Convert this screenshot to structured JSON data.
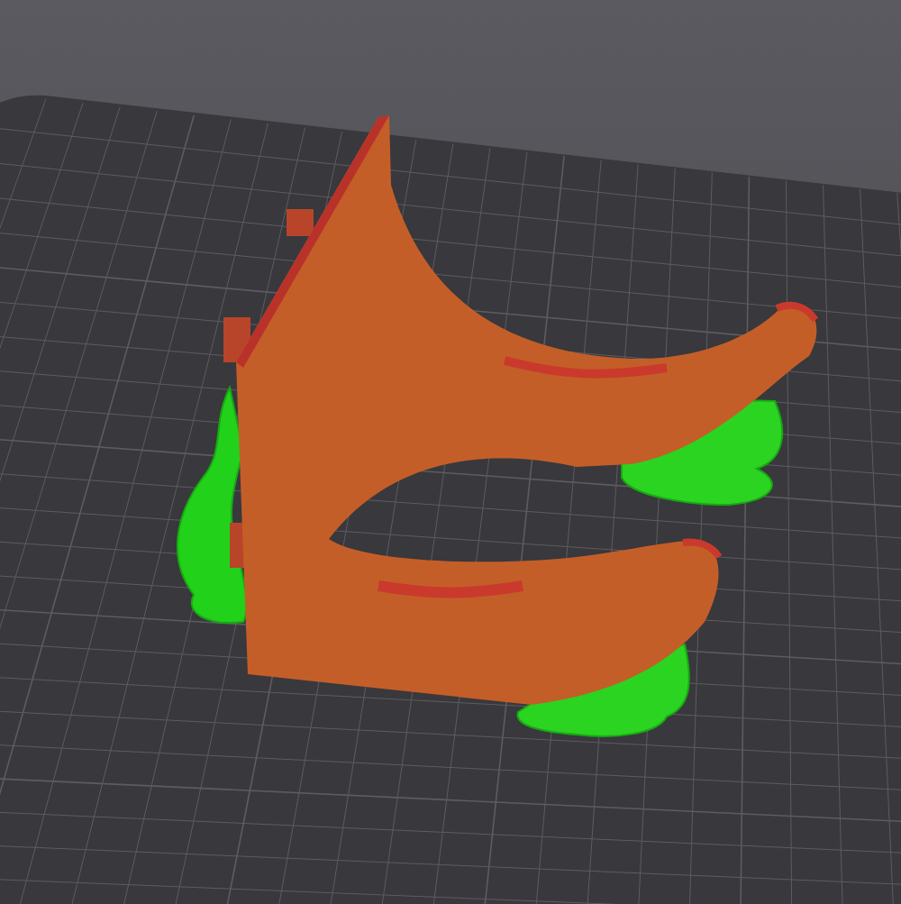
{
  "viewport": {
    "kind": "print-preview"
  }
}
